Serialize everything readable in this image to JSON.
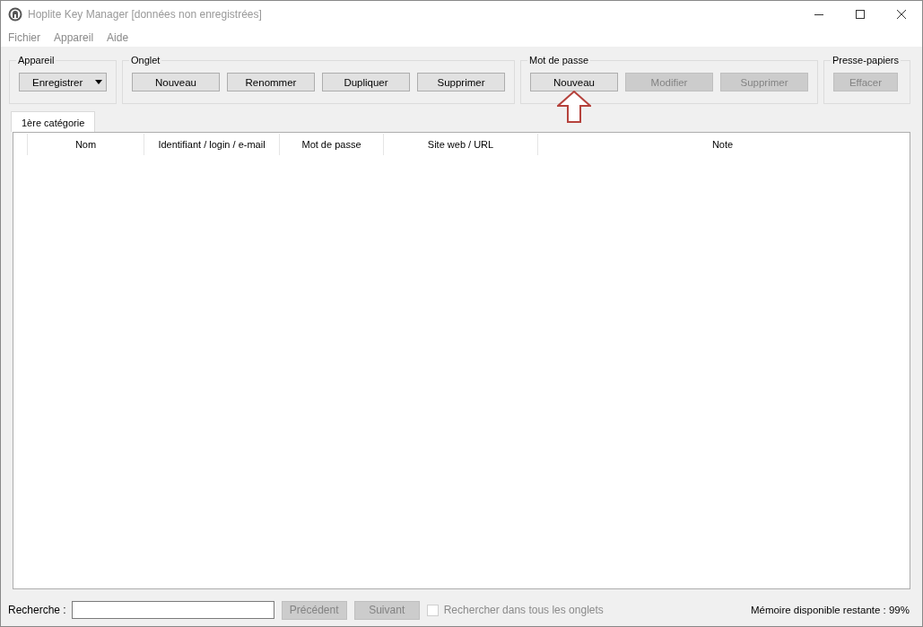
{
  "window": {
    "title": "Hoplite Key Manager [données non enregistrées]"
  },
  "menu": [
    "Fichier",
    "Appareil",
    "Aide"
  ],
  "groups": [
    {
      "title": "Appareil",
      "buttons": [
        {
          "label": "Enregistrer",
          "kind": "dropdown",
          "disabled": false
        }
      ]
    },
    {
      "title": "Onglet",
      "buttons": [
        {
          "label": "Nouveau",
          "kind": "button",
          "disabled": false
        },
        {
          "label": "Renommer",
          "kind": "button",
          "disabled": false
        },
        {
          "label": "Dupliquer",
          "kind": "button",
          "disabled": false
        },
        {
          "label": "Supprimer",
          "kind": "button",
          "disabled": false
        }
      ]
    },
    {
      "title": "Mot de passe",
      "buttons": [
        {
          "label": "Nouveau",
          "kind": "button",
          "disabled": false,
          "highlighted": true
        },
        {
          "label": "Modifier",
          "kind": "button",
          "disabled": true
        },
        {
          "label": "Supprimer",
          "kind": "button",
          "disabled": true
        }
      ]
    },
    {
      "title": "Presse-papiers",
      "buttons": [
        {
          "label": "Effacer",
          "kind": "button",
          "disabled": true
        }
      ]
    }
  ],
  "tabs": [
    {
      "label": "1ère catégorie",
      "selected": true
    }
  ],
  "table": {
    "columns": [
      "Nom",
      "Identifiant / login / e-mail",
      "Mot de passe",
      "Site web / URL",
      "Note"
    ]
  },
  "search": {
    "label": "Recherche :",
    "prev": {
      "label": "Précédent",
      "disabled": true
    },
    "next": {
      "label": "Suivant",
      "disabled": true
    },
    "all_tabs": {
      "label": "Rechercher dans tous les onglets",
      "checked": false,
      "disabled": true
    }
  },
  "status": "Mémoire disponible restante : 99%"
}
